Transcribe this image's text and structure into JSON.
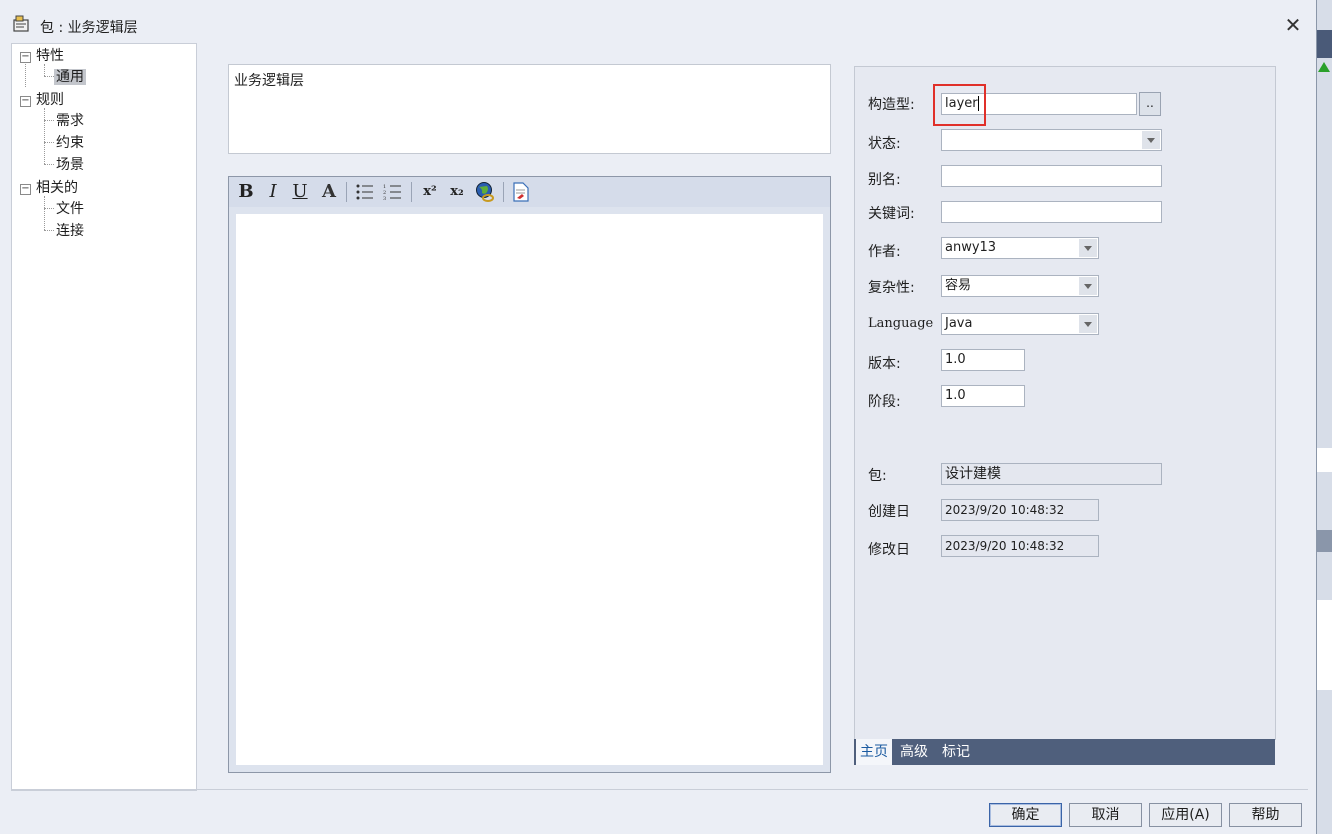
{
  "window": {
    "title": "包 : 业务逻辑层",
    "close_label": "✕"
  },
  "tree": {
    "nodes": [
      {
        "label": "特性",
        "expander": "−"
      },
      {
        "label": "通用"
      },
      {
        "label": "规则",
        "expander": "−"
      },
      {
        "label": "需求"
      },
      {
        "label": "约束"
      },
      {
        "label": "场景"
      },
      {
        "label": "相关的",
        "expander": "−"
      },
      {
        "label": "文件"
      },
      {
        "label": "连接"
      }
    ]
  },
  "name_field": {
    "value": "业务逻辑层"
  },
  "toolbar": {
    "bold": "B",
    "italic": "I",
    "underline": "U",
    "font_color": "A",
    "superscript": "x²",
    "subscript": "x₂"
  },
  "properties": {
    "stereotype": {
      "label": "构造型:",
      "value": "layer",
      "button": ".."
    },
    "status": {
      "label": "状态:",
      "value": ""
    },
    "alias": {
      "label": "别名:",
      "value": ""
    },
    "keywords": {
      "label": "关键词:",
      "value": ""
    },
    "author": {
      "label": "作者:",
      "value": "anwy13"
    },
    "complexity": {
      "label": "复杂性:",
      "value": "容易"
    },
    "language": {
      "label": "Language",
      "value": "Java"
    },
    "version": {
      "label": "版本:",
      "value": "1.0"
    },
    "phase": {
      "label": "阶段:",
      "value": "1.0"
    },
    "package": {
      "label": "包:",
      "value": "设计建模"
    },
    "created": {
      "label": "创建日",
      "value": "2023/9/20 10:48:32"
    },
    "modified": {
      "label": "修改日",
      "value": "2023/9/20 10:48:32"
    }
  },
  "tabs": [
    {
      "label": "主页"
    },
    {
      "label": "高级"
    },
    {
      "label": "标记"
    }
  ],
  "buttons": {
    "ok": "确定",
    "cancel": "取消",
    "apply": "应用(A)",
    "help": "帮助"
  },
  "colors": {
    "highlight": "#e0302a",
    "tab_bar": "#4f5f7c",
    "accent_text": "#1a5aa0"
  }
}
